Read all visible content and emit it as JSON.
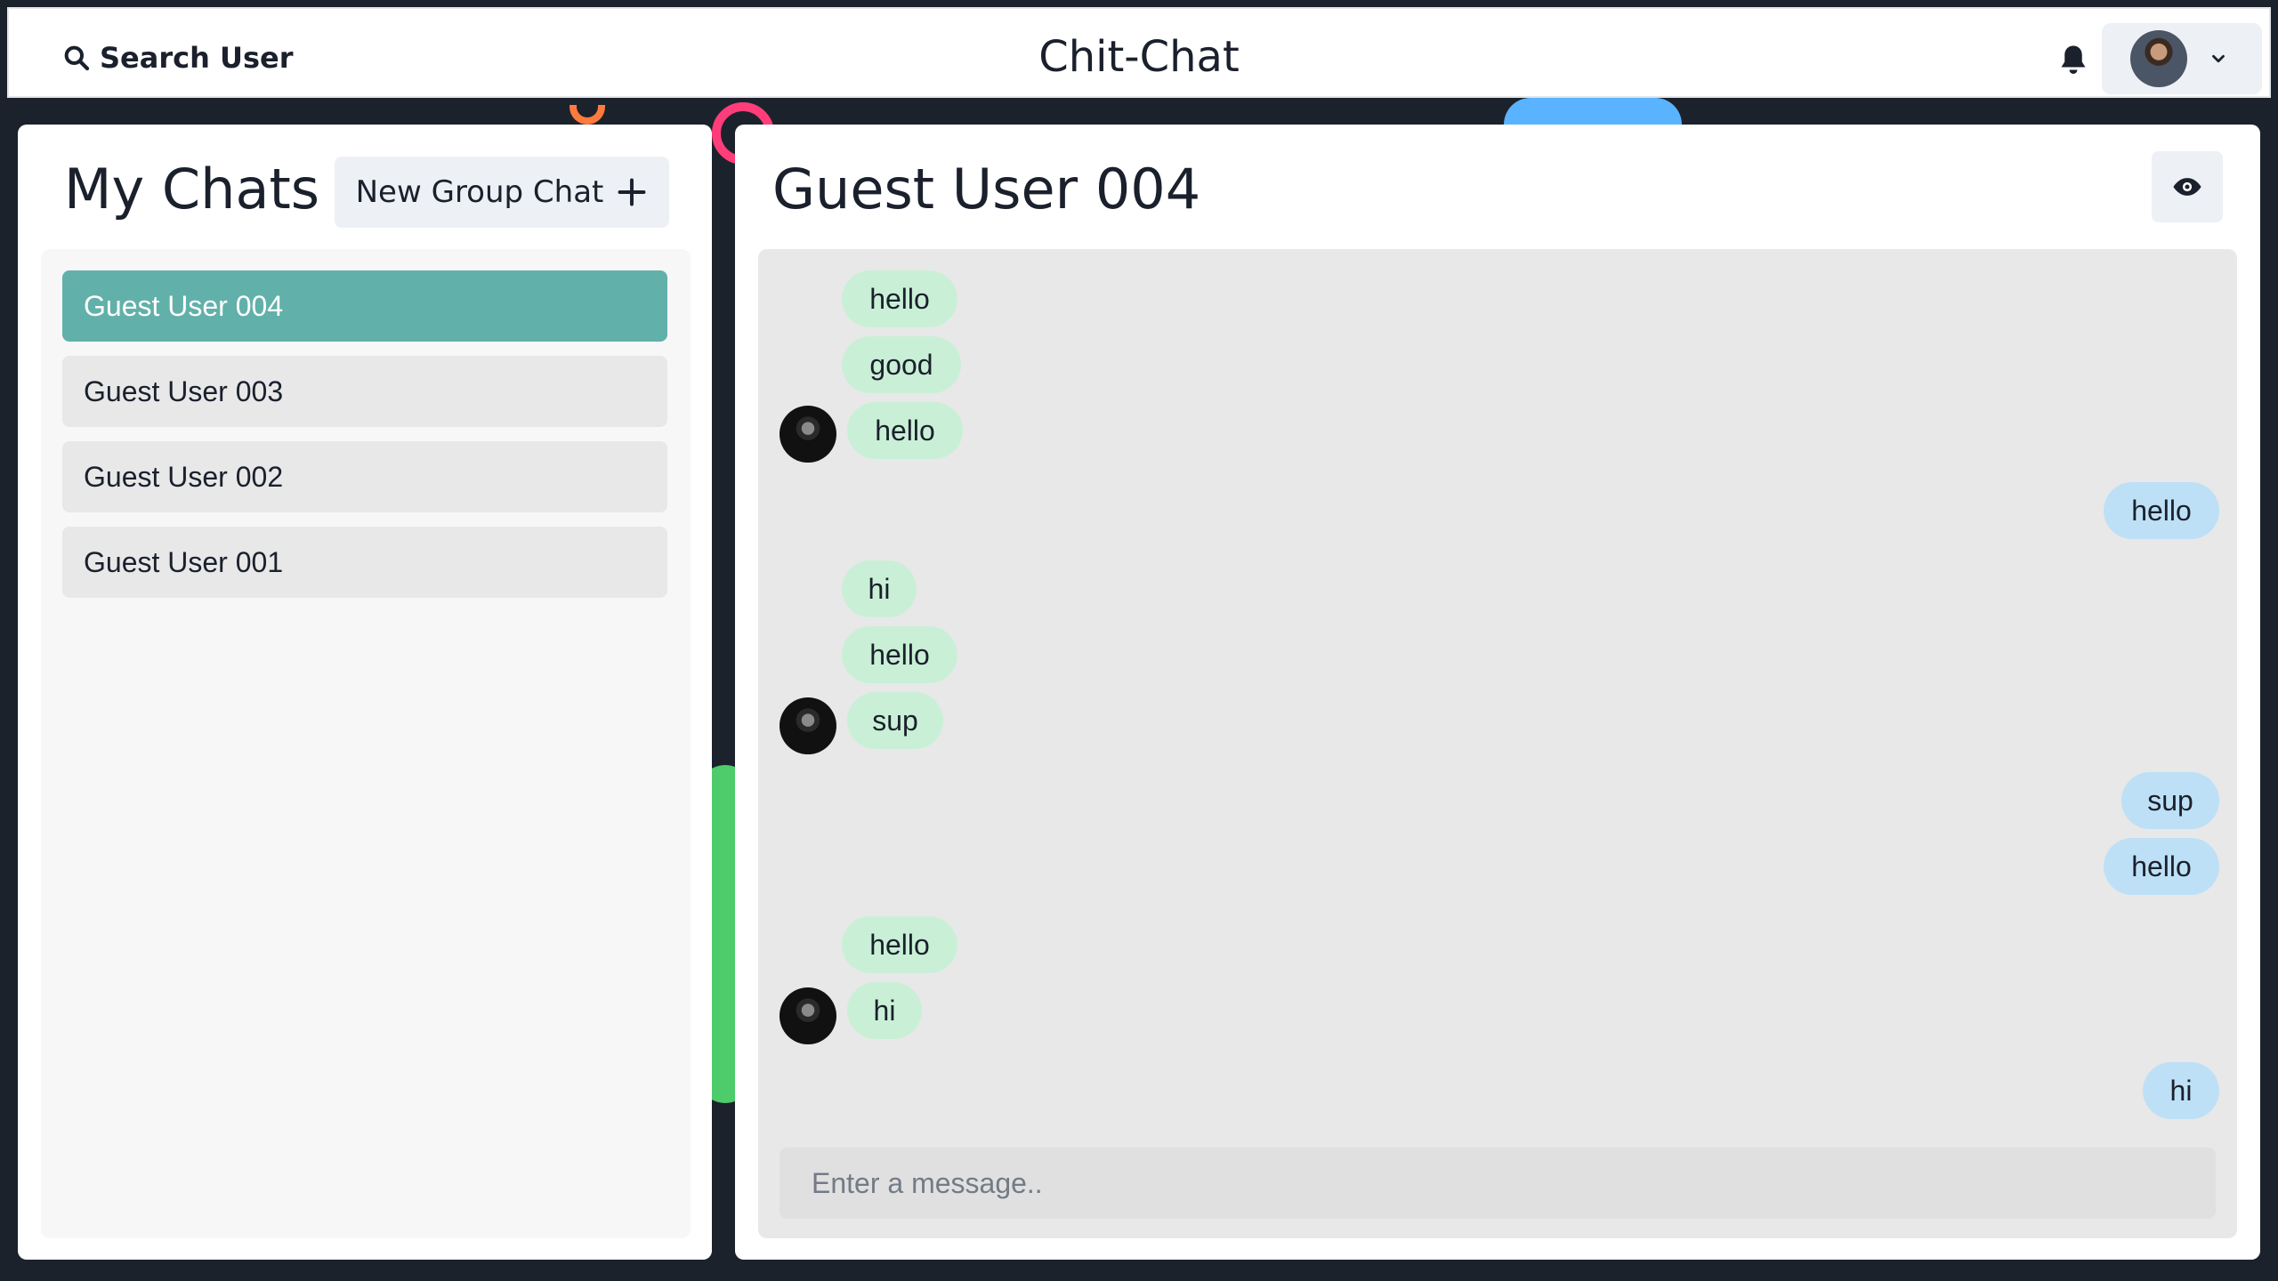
{
  "app": {
    "title": "Chit-Chat"
  },
  "header": {
    "search_label": "Search User",
    "search_icon": "search-icon",
    "bell_icon": "bell-icon",
    "profile_chevron_icon": "chevron-down-icon"
  },
  "left": {
    "title": "My Chats",
    "new_group_label": "New Group Chat",
    "new_group_icon": "plus-icon",
    "chats": [
      {
        "name": "Guest User 004",
        "active": true
      },
      {
        "name": "Guest User 003",
        "active": false
      },
      {
        "name": "Guest User 002",
        "active": false
      },
      {
        "name": "Guest User 001",
        "active": false
      }
    ]
  },
  "right": {
    "title": "Guest User 004",
    "view_icon": "eye-icon",
    "messages": [
      {
        "text": "hello",
        "direction": "in",
        "show_avatar": false
      },
      {
        "text": "good",
        "direction": "in",
        "show_avatar": false
      },
      {
        "text": "hello",
        "direction": "in",
        "show_avatar": true
      },
      {
        "text": "hello",
        "direction": "out",
        "show_avatar": false
      },
      {
        "text": "hi",
        "direction": "in",
        "show_avatar": false
      },
      {
        "text": "hello",
        "direction": "in",
        "show_avatar": false
      },
      {
        "text": "sup",
        "direction": "in",
        "show_avatar": true
      },
      {
        "text": "sup",
        "direction": "out",
        "show_avatar": false
      },
      {
        "text": "hello",
        "direction": "out",
        "show_avatar": false
      },
      {
        "text": "hello",
        "direction": "in",
        "show_avatar": false
      },
      {
        "text": "hi",
        "direction": "in",
        "show_avatar": true
      },
      {
        "text": "hi",
        "direction": "out",
        "show_avatar": false
      }
    ],
    "input_placeholder": "Enter a message..",
    "input_value": ""
  },
  "colors": {
    "active_chat": "#62b0aa",
    "incoming_bubble": "#c9f0d6",
    "outgoing_bubble": "#bde0f6"
  }
}
